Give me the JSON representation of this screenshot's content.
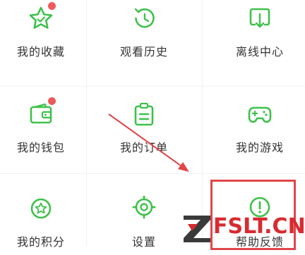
{
  "menu": {
    "items": [
      {
        "label": "我的收藏",
        "icon": "star-icon",
        "badge_dot": true
      },
      {
        "label": "观看历史",
        "icon": "history-clock-icon",
        "badge_dot": false
      },
      {
        "label": "离线中心",
        "icon": "download-box-icon",
        "badge_dot": false
      },
      {
        "label": "我的钱包",
        "icon": "wallet-icon",
        "badge_dot": true
      },
      {
        "label": "我的订单",
        "icon": "order-clipboard-icon",
        "badge_dot": false
      },
      {
        "label": "我的游戏",
        "icon": "gamepad-icon",
        "badge_dot": false
      },
      {
        "label": "我的积分",
        "icon": "points-star-icon",
        "badge_dot": false
      },
      {
        "label": "设置",
        "icon": "settings-gear-icon",
        "badge_dot": false
      },
      {
        "label": "帮助反馈",
        "icon": "help-exclamation-icon",
        "badge_dot": false
      }
    ]
  },
  "watermark": {
    "text": "FSLT.CN"
  },
  "colors": {
    "icon_green": "#3fc14b",
    "label_text": "#333333",
    "badge_red": "#ee5a5a",
    "annotation_red": "#e0464a"
  }
}
